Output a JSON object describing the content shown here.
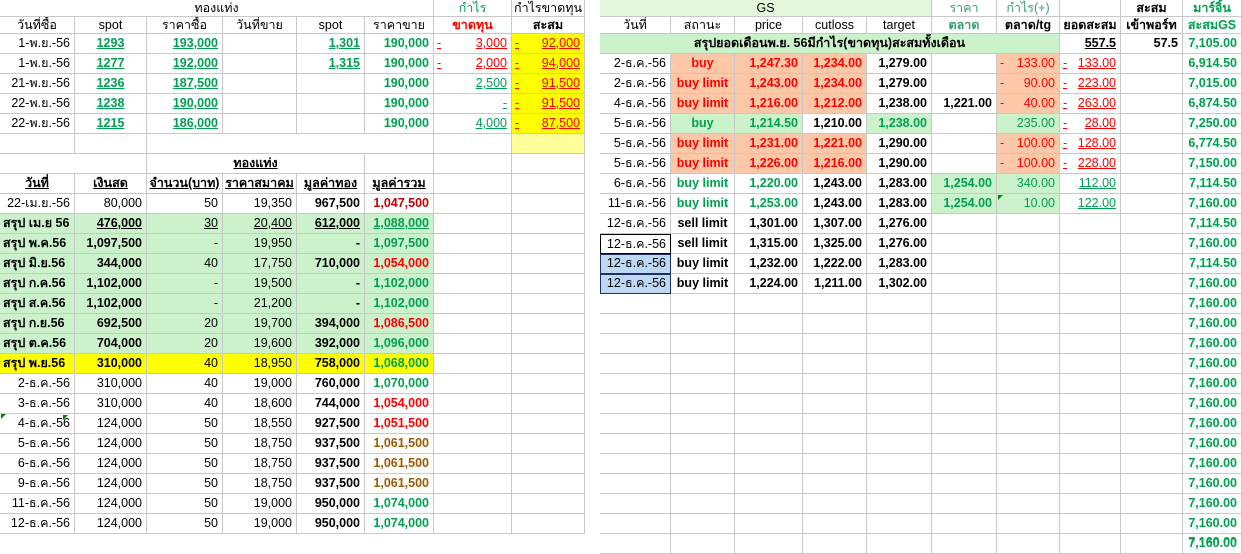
{
  "left_header": {
    "group_title": "ทองแท่ง",
    "profit_group": "กำไร",
    "profit_cum_group": "กำไรขาดทุน",
    "col_buy_date": "วันที่ซื้อ",
    "col_spot_buy": "spot",
    "col_buy_price": "ราคาซื้อ",
    "col_sell_date": "วันที่ขาย",
    "col_spot_sell": "spot",
    "col_sell_price": "ราคาขาย",
    "col_loss": "ขาดทุน",
    "col_cumulative": "สะสม"
  },
  "buys": [
    {
      "date": "1-พ.ย.-56",
      "spot": "1293",
      "price": "193,000",
      "sell_date": "",
      "sell_spot": "1,301",
      "sell_price": "190,000",
      "profit": "3,000",
      "cum": "92,000"
    },
    {
      "date": "1-พ.ย.-56",
      "spot": "1277",
      "price": "192,000",
      "sell_date": "",
      "sell_spot": "1,315",
      "sell_price": "190,000",
      "profit": "2,000",
      "cum": "94,000"
    },
    {
      "date": "21-พ.ย.-56",
      "spot": "1236",
      "price": "187,500",
      "sell_date": "",
      "sell_spot": "",
      "sell_price": "190,000",
      "profit": "2,500",
      "cum": "91,500"
    },
    {
      "date": "22-พ.ย.-56",
      "spot": "1238",
      "price": "190,000",
      "sell_date": "",
      "sell_spot": "",
      "sell_price": "190,000",
      "profit": "-",
      "cum": "91,500"
    },
    {
      "date": "22-พ.ย.-56",
      "spot": "1215",
      "price": "186,000",
      "sell_date": "",
      "sell_spot": "",
      "sell_price": "190,000",
      "profit": "4,000",
      "cum": "87,500"
    }
  ],
  "summary_header": {
    "group_title": "ทองแท่ง",
    "col_date": "วันที่",
    "col_cash": "เงินสด",
    "col_qty": "จำนวน(บาท)",
    "col_assoc_price": "ราคาสมาคม",
    "col_gold_value": "มูลค่าทอง",
    "col_total_value": "มูลค่ารวม"
  },
  "summary_rows": [
    {
      "date": "22-เม.ย.-56",
      "cash": "80,000",
      "qty": "50",
      "price": "19,350",
      "gold": "967,500",
      "total": "1,047,500"
    },
    {
      "date": "สรุป เม.ย 56",
      "cash": "476,000",
      "qty": "30",
      "price": "20,400",
      "gold": "612,000",
      "total": "1,088,000"
    },
    {
      "date": "สรุป พ.ค.56",
      "cash": "1,097,500",
      "qty": "-",
      "price": "19,950",
      "gold": "-",
      "total": "1,097,500"
    },
    {
      "date": "สรุป มิ.ย.56",
      "cash": "344,000",
      "qty": "40",
      "price": "17,750",
      "gold": "710,000",
      "total": "1,054,000"
    },
    {
      "date": "สรุป ก.ค.56",
      "cash": "1,102,000",
      "qty": "-",
      "price": "19,500",
      "gold": "-",
      "total": "1,102,000"
    },
    {
      "date": "สรุป ส.ค.56",
      "cash": "1,102,000",
      "qty": "-",
      "price": "21,200",
      "gold": "-",
      "total": "1,102,000"
    },
    {
      "date": "สรุป ก.ย.56",
      "cash": "692,500",
      "qty": "20",
      "price": "19,700",
      "gold": "394,000",
      "total": "1,086,500"
    },
    {
      "date": "สรุป ต.ค.56",
      "cash": "704,000",
      "qty": "20",
      "price": "19,600",
      "gold": "392,000",
      "total": "1,096,000"
    },
    {
      "date": "สรุป พ.ย.56",
      "cash": "310,000",
      "qty": "40",
      "price": "18,950",
      "gold": "758,000",
      "total": "1,068,000"
    },
    {
      "date": "2-ธ.ค.-56",
      "cash": "310,000",
      "qty": "40",
      "price": "19,000",
      "gold": "760,000",
      "total": "1,070,000"
    },
    {
      "date": "3-ธ.ค.-56",
      "cash": "310,000",
      "qty": "40",
      "price": "18,600",
      "gold": "744,000",
      "total": "1,054,000"
    },
    {
      "date": "4-ธ.ค.-56",
      "cash": "124,000",
      "qty": "50",
      "price": "18,550",
      "gold": "927,500",
      "total": "1,051,500"
    },
    {
      "date": "5-ธ.ค.-56",
      "cash": "124,000",
      "qty": "50",
      "price": "18,750",
      "gold": "937,500",
      "total": "1,061,500"
    },
    {
      "date": "6-ธ.ค.-56",
      "cash": "124,000",
      "qty": "50",
      "price": "18,750",
      "gold": "937,500",
      "total": "1,061,500"
    },
    {
      "date": "9-ธ.ค.-56",
      "cash": "124,000",
      "qty": "50",
      "price": "18,750",
      "gold": "937,500",
      "total": "1,061,500"
    },
    {
      "date": "11-ธ.ค.-56",
      "cash": "124,000",
      "qty": "50",
      "price": "19,000",
      "gold": "950,000",
      "total": "1,074,000"
    },
    {
      "date": "12-ธ.ค.-56",
      "cash": "124,000",
      "qty": "50",
      "price": "19,000",
      "gold": "950,000",
      "total": "1,074,000"
    }
  ],
  "right_header": {
    "gs_title": "GS",
    "price_group": "ราคา",
    "profit_group": "กำไร(+)",
    "cum_group": "สะสม",
    "margin_group": "มาร์จิ้น",
    "col_date": "วันที่",
    "col_status": "สถานะ",
    "col_price": "price",
    "col_cutloss": "cutloss",
    "col_target": "target",
    "col_market": "ตลาด",
    "col_market_tg": "ตลาด/tg",
    "col_cum_total": "ยอดสะสม",
    "col_import": "เข้าพอร์ท",
    "col_cum_gs": "สะสมGS"
  },
  "month_summary": {
    "label": "สรุปยอดเดือนพ.ย. 56มีกำไร(ขาดทุน)สะสมทั้งเดือน",
    "cum": "557.5",
    "import": "57.5",
    "margin": "7,105.00"
  },
  "trades": [
    {
      "date": "2-ธ.ค.-56",
      "status": "buy",
      "price": "1,247.30",
      "cutloss": "1,234.00",
      "target": "1,279.00",
      "market": "",
      "profit": "133.00",
      "cum": "133.00",
      "margin": "6,914.50"
    },
    {
      "date": "2-ธ.ค.-56",
      "status": "buy limit",
      "price": "1,243.00",
      "cutloss": "1,234.00",
      "target": "1,279.00",
      "market": "",
      "profit": "90.00",
      "cum": "223.00",
      "margin": "7,015.00"
    },
    {
      "date": "4-ธ.ค.-56",
      "status": "buy limit",
      "price": "1,216.00",
      "cutloss": "1,212.00",
      "target": "1,238.00",
      "market": "1,221.00",
      "profit": "40.00",
      "cum": "263.00",
      "margin": "6,874.50"
    },
    {
      "date": "5-ธ.ค.-56",
      "status": "buy",
      "price": "1,214.50",
      "cutloss": "1,210.00",
      "target": "1,238.00",
      "market": "",
      "profit": "235.00",
      "cum": "28.00",
      "margin": "7,250.00"
    },
    {
      "date": "5-ธ.ค.-56",
      "status": "buy limit",
      "price": "1,231.00",
      "cutloss": "1,221.00",
      "target": "1,290.00",
      "market": "",
      "profit": "100.00",
      "cum": "128.00",
      "margin": "6,774.50"
    },
    {
      "date": "5-ธ.ค.-56",
      "status": "buy limit",
      "price": "1,226.00",
      "cutloss": "1,216.00",
      "target": "1,290.00",
      "market": "",
      "profit": "100.00",
      "cum": "228.00",
      "margin": "7,150.00"
    },
    {
      "date": "6-ธ.ค.-56",
      "status": "buy limit",
      "price": "1,220.00",
      "cutloss": "1,243.00",
      "target": "1,283.00",
      "market": "1,254.00",
      "profit": "340.00",
      "cum": "112.00",
      "margin": "7,114.50"
    },
    {
      "date": "11-ธ.ค.-56",
      "status": "buy limit",
      "price": "1,253.00",
      "cutloss": "1,243.00",
      "target": "1,283.00",
      "market": "1,254.00",
      "profit": "10.00",
      "cum": "122.00",
      "margin": "7,160.00"
    },
    {
      "date": "12-ธ.ค.-56",
      "status": "sell limit",
      "price": "1,301.00",
      "cutloss": "1,307.00",
      "target": "1,276.00",
      "market": "",
      "profit": "",
      "cum": "",
      "margin": "7,114.50"
    },
    {
      "date": "12-ธ.ค.-56",
      "status": "sell limit",
      "price": "1,315.00",
      "cutloss": "1,325.00",
      "target": "1,276.00",
      "market": "",
      "profit": "",
      "cum": "",
      "margin": "7,160.00"
    },
    {
      "date": "12-ธ.ค.-56",
      "status": "buy limit",
      "price": "1,232.00",
      "cutloss": "1,222.00",
      "target": "1,283.00",
      "market": "",
      "profit": "",
      "cum": "",
      "margin": "7,114.50"
    },
    {
      "date": "12-ธ.ค.-56",
      "status": "buy limit",
      "price": "1,224.00",
      "cutloss": "1,211.00",
      "target": "1,302.00",
      "market": "",
      "profit": "",
      "cum": "",
      "margin": "7,160.00"
    }
  ],
  "margin_tail": [
    "7,160.00",
    "7,160.00",
    "7,160.00",
    "7,160.00",
    "7,160.00",
    "7,160.00",
    "7,160.00",
    "7,160.00",
    "7,160.00",
    "7,160.00",
    "7,160.00",
    "7,160.00",
    "7,160.00"
  ],
  "margin_last_partial": "7,160.00",
  "colors": {
    "green_text": "#00a050",
    "red_text": "#ff0000",
    "green_fill": "#ccf2cc",
    "yellow_fill": "#ffff00",
    "salmon_fill": "#fcc8a8",
    "selection": "#bcd8f2"
  }
}
